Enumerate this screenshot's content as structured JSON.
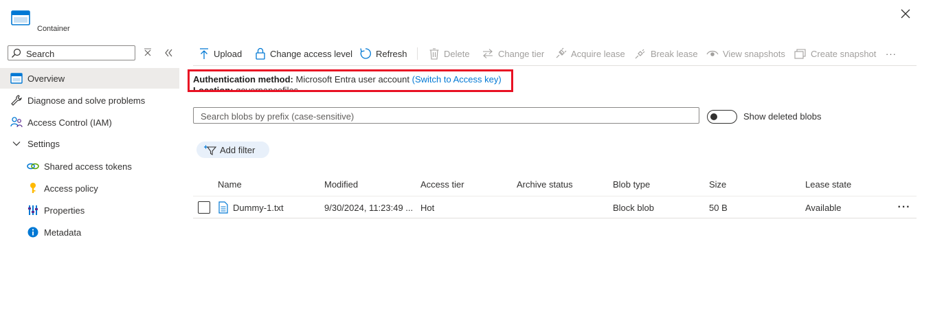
{
  "header": {
    "subtitle": "Container"
  },
  "sidebar": {
    "search_placeholder": "Search",
    "items": [
      {
        "label": "Overview"
      },
      {
        "label": "Diagnose and solve problems"
      },
      {
        "label": "Access Control (IAM)"
      },
      {
        "label": "Settings"
      },
      {
        "label": "Shared access tokens"
      },
      {
        "label": "Access policy"
      },
      {
        "label": "Properties"
      },
      {
        "label": "Metadata"
      }
    ]
  },
  "toolbar": {
    "upload": "Upload",
    "change_access_level": "Change access level",
    "refresh": "Refresh",
    "delete": "Delete",
    "change_tier": "Change tier",
    "acquire_lease": "Acquire lease",
    "break_lease": "Break lease",
    "view_snapshots": "View snapshots",
    "create_snapshot": "Create snapshot",
    "more": "···"
  },
  "auth": {
    "label": "Authentication method:",
    "value": "Microsoft Entra user account",
    "switch_link": "(Switch to Access key)",
    "location_label": "Location:",
    "location_value": "governancefiles"
  },
  "blob_search": {
    "placeholder": "Search blobs by prefix (case-sensitive)"
  },
  "show_deleted": {
    "label": "Show deleted blobs",
    "enabled": false
  },
  "filter": {
    "add_label": "Add filter"
  },
  "table": {
    "columns": [
      "Name",
      "Modified",
      "Access tier",
      "Archive status",
      "Blob type",
      "Size",
      "Lease state"
    ],
    "rows": [
      {
        "name": "Dummy-1.txt",
        "modified": "9/30/2024, 11:23:49 ...",
        "access_tier": "Hot",
        "archive_status": "",
        "blob_type": "Block blob",
        "size": "50 B",
        "lease_state": "Available",
        "more": "···"
      }
    ]
  },
  "colors": {
    "accent": "#0078d4",
    "highlight_box": "#e81123",
    "selected_nav": "#edebe9"
  }
}
